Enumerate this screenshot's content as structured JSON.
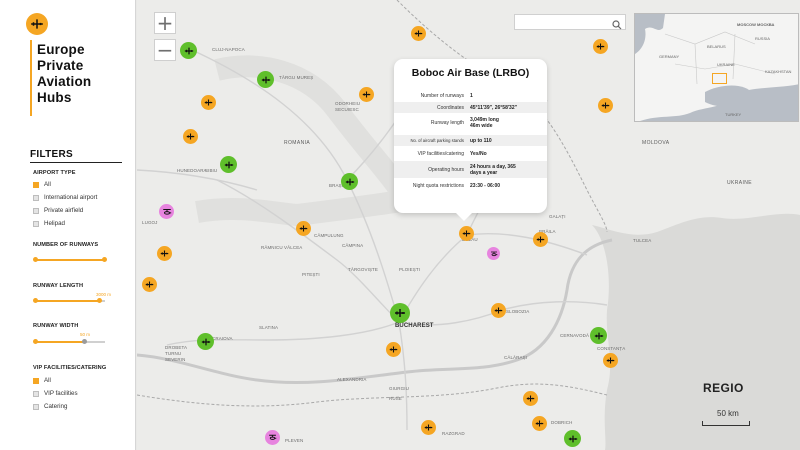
{
  "header": {
    "title_line1": "Europe",
    "title_line2": "Private",
    "title_line3": "Aviation",
    "title_line4": "Hubs",
    "logo_icon": "airplane-icon"
  },
  "filters": {
    "heading": "FILTERS",
    "airport_type": {
      "label": "AIRPORT TYPE",
      "options": [
        {
          "label": "All",
          "checked": true
        },
        {
          "label": "International airport",
          "checked": false
        },
        {
          "label": "Private airfield",
          "checked": false
        },
        {
          "label": "Helipad",
          "checked": false
        }
      ]
    },
    "number_of_runways": {
      "label": "NUMBER OF RUNWAYS",
      "range": [
        0,
        1
      ]
    },
    "runway_length": {
      "label": "RUNWAY LENGTH",
      "value_label": "3000 m",
      "value": 0.92
    },
    "runway_width": {
      "label": "RUNWAY WIDTH",
      "value_label": "50 m",
      "value": 0.7
    },
    "vip": {
      "label": "VIP FACILITIES/CATERING",
      "options": [
        {
          "label": "All",
          "checked": true
        },
        {
          "label": "VIP facilities",
          "checked": false
        },
        {
          "label": "Catering",
          "checked": false
        }
      ]
    }
  },
  "map": {
    "search_placeholder": "",
    "zoom_in": "+",
    "zoom_out": "−",
    "places": {
      "cluj": "CLUJ-NAPOCA",
      "targu": "TÂRGU MUREȘ",
      "odorheiu": "ODORHEIU SECUIESC",
      "romania": "ROMANIA",
      "sibiu": "SIBIU",
      "brasov": "BRAȘOV",
      "hunedoara": "HUNEDOARA",
      "campulung": "CÂMPULUNG",
      "ramnicu": "RÂMNICU VÂLCEA",
      "campina": "CÂMPINA",
      "buzau": "BUZĂU",
      "pitesti": "PITEȘTI",
      "targoviste": "TÂRGOVIȘTE",
      "ploiesti": "PLOIEȘTI",
      "slobozia": "SLOBOZIA",
      "bucharest": "BUCHAREST",
      "craiova": "CRAIOVA",
      "slatina": "SLATINA",
      "alexandria": "ALEXANDRIA",
      "giurgiu": "GIURGIU",
      "calarasi": "CĂLĂRAȘI",
      "cernavoda": "CERNAVODĂ",
      "constanta": "CONSTANȚA",
      "ruse": "RUSE",
      "pleven": "PLEVEN",
      "razgrad": "RAZGRAD",
      "dobrich": "DOBRICH",
      "tulcea": "TULCEA",
      "galati": "GALAȚI",
      "braila": "BRĂILA",
      "focsani": "FOCȘANI",
      "bacau": "BACĂU",
      "iasi": "IAȘI",
      "drobeta": "DROBETA TURNU SEVERIN",
      "lugoj": "LUGOJ",
      "moldova": "MOLDOVA",
      "ukraine": "UKRAINE"
    },
    "minimap": {
      "moscow": "MOSCOW МОСКВА",
      "belarus": "BELARUS",
      "ukraine": "UKRAINE",
      "kazakhstan": "KAZAKHSTAN",
      "russia": "RUSSIA",
      "turkey": "TURKEY",
      "germany": "GERMANY"
    },
    "brand": "REGIO",
    "scale": "50 km"
  },
  "popup": {
    "title": "Boboc Air Base (LRBO)",
    "rows": [
      {
        "k": "Number of runways",
        "v": "1"
      },
      {
        "k": "Coordinates",
        "v": "45°11'39\", 26°58'32\""
      },
      {
        "k": "Runway length",
        "v": "3,049m long 46m wide"
      },
      {
        "k": "No. of aircraft parking stands",
        "v": "up to 110"
      },
      {
        "k": "VIP facilities/catering",
        "v": "Yes/No"
      },
      {
        "k": "Operating hours",
        "v": "24 hours a day, 365 days a year"
      },
      {
        "k": "Night quota restrictions",
        "v": "23:30 - 06:00"
      }
    ]
  },
  "colors": {
    "accent": "#f5a623",
    "international": "#5fbf2b",
    "helipad": "#e784df"
  }
}
